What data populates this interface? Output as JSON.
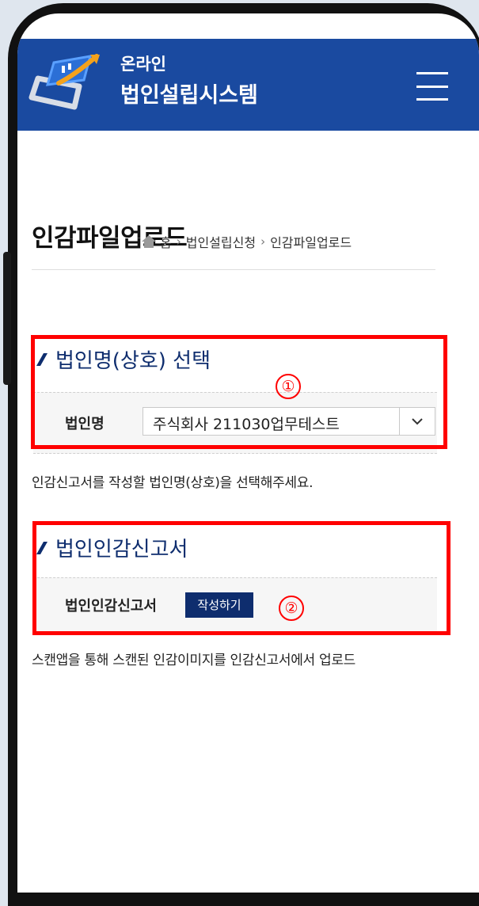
{
  "header": {
    "brand_line1": "온라인",
    "brand_line2": "법인설립시스템",
    "menu_icon": "hamburger-menu-icon"
  },
  "page": {
    "title": "인감파일업로드",
    "breadcrumb": {
      "home_label": "홈",
      "items": [
        "법인설립신청",
        "인감파일업로드"
      ]
    }
  },
  "section1": {
    "title": "법인명(상호) 선택",
    "field_label": "법인명",
    "select_value": "주식회사 211030업무테스트",
    "help_text": "인감신고서를 작성할 법인명(상호)을 선택해주세요.",
    "marker": "①"
  },
  "section2": {
    "title": "법인인감신고서",
    "field_label": "법인인감신고서",
    "button_label": "작성하기",
    "help_text": "스캔앱을 통해 스캔된 인감이미지를 인감신고서에서 업로드",
    "marker": "②"
  },
  "colors": {
    "header_bg": "#1a4aa0",
    "section_title": "#0e2d6e",
    "button_bg": "#0e2d6e",
    "highlight": "#ff0000"
  }
}
